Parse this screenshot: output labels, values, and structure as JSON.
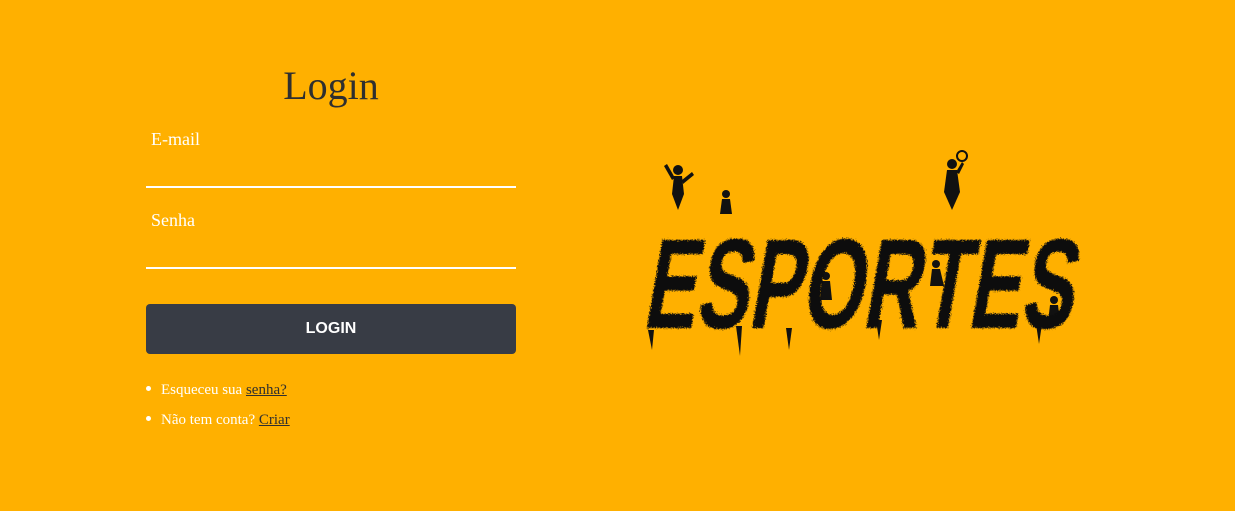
{
  "login": {
    "title": "Login",
    "email_label": "E-mail",
    "email_value": "",
    "senha_label": "Senha",
    "senha_value": "",
    "button_label": "LOGIN"
  },
  "links": {
    "forgot_prefix": "Esqueceu sua ",
    "forgot_link": "senha?",
    "signup_prefix": "Não tem conta? ",
    "signup_link": "Criar"
  },
  "logo": {
    "text": "ESPORTES",
    "icon": "sports-silhouettes-logo",
    "color": "#111111"
  },
  "colors": {
    "background": "#FFB000",
    "button": "#383C45",
    "title": "#2F2F2F",
    "label": "#FFFFFF"
  }
}
